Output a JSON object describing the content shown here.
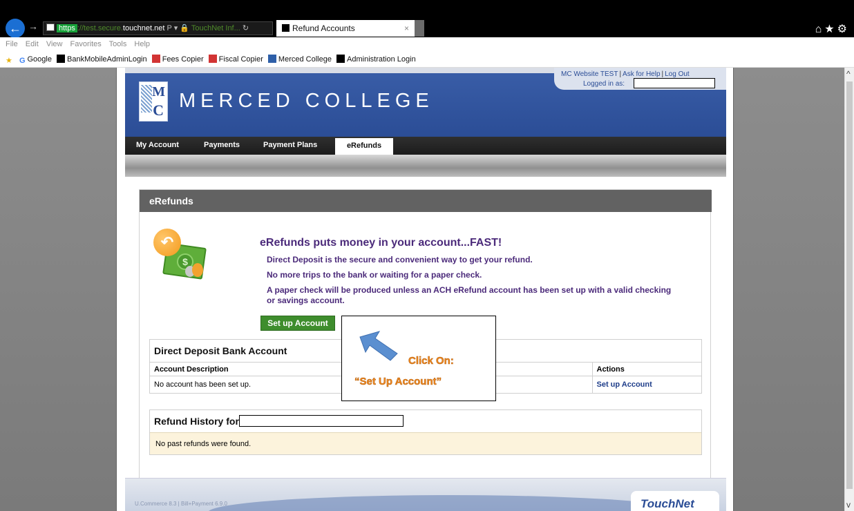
{
  "browser": {
    "protocol": "https",
    "url_prefix": "://test.secure.",
    "domain": "touchnet.net",
    "url_search_hint": "P ▾",
    "site_label": "TouchNet Inf...",
    "tab_title": "Refund Accounts",
    "tab_close": "×",
    "right_icons": "⌂★⚙",
    "menu": [
      "File",
      "Edit",
      "View",
      "Favorites",
      "Tools",
      "Help"
    ],
    "favorites": [
      {
        "label": "Google",
        "icon": "google-icon"
      },
      {
        "label": "BankMobileAdminLogin",
        "icon": "black-square-icon"
      },
      {
        "label": "Fees Copier",
        "icon": "red-icon"
      },
      {
        "label": "Fiscal Copier",
        "icon": "red-icon"
      },
      {
        "label": "Merced College",
        "icon": "college-icon"
      },
      {
        "label": "Administration Login",
        "icon": "black-square-icon"
      }
    ]
  },
  "header": {
    "college_name": "MERCED COLLEGE",
    "logo_m": "M",
    "logo_c": "C",
    "util_links": [
      "MC Website TEST",
      "Ask for Help",
      "Log Out"
    ],
    "logged_in_label": "Logged in as:"
  },
  "nav": {
    "items": [
      "My Account",
      "Payments",
      "Payment Plans",
      "eRefunds"
    ],
    "active": "eRefunds"
  },
  "panel": {
    "title": "eRefunds",
    "promo_title": "eRefunds puts money in your account...FAST!",
    "promo_lines": [
      "Direct Deposit is the secure and convenient way to get your refund.",
      "No more trips to the bank or waiting for a paper check.",
      "A paper check will be produced unless an ACH eRefund account has been set up with a valid checking or savings account."
    ],
    "setup_button": "Set up Account"
  },
  "direct_deposit": {
    "title": "Direct Deposit Bank Account",
    "columns": [
      "Account Description",
      "Actions"
    ],
    "empty_message": "No account has been set up.",
    "action_link": "Set up Account"
  },
  "refund_history": {
    "title": "Refund History for",
    "empty_message": "No past refunds were found."
  },
  "callout": {
    "line1": "Click On:",
    "line2": "“Set Up Account”"
  },
  "footer": {
    "version": "U.Commerce 8.3 | Bill+Payment 6.9.0",
    "brand": "TouchNet"
  },
  "colors": {
    "header_blue": "#2b4d96",
    "promo_purple": "#4b2a7a",
    "button_green": "#3e8d2d",
    "callout_orange": "#f08a22"
  }
}
